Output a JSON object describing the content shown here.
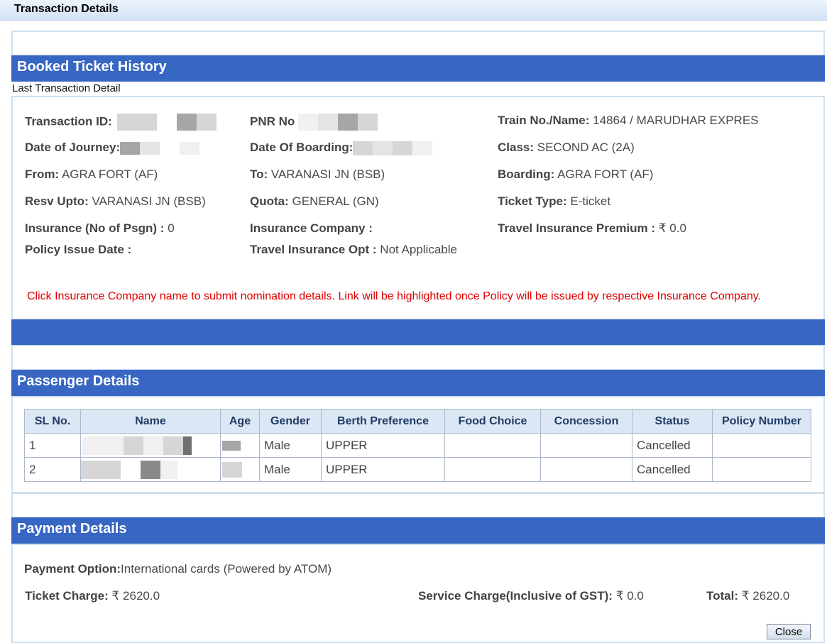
{
  "window": {
    "title": "Transaction Details"
  },
  "booked_section": {
    "title": "Booked Ticket History",
    "subtitle": "Last Transaction Detail"
  },
  "transaction": {
    "transaction_id_label": "Transaction ID:",
    "pnr_label": "PNR No",
    "train_label": "Train No./Name:",
    "train_value": " 14864 /  MARUDHAR EXPRES",
    "doj_label": "Date of Journey:",
    "dob_label": "Date Of Boarding:",
    "class_label": "Class:",
    "class_value": " SECOND AC (2A)",
    "from_label": "From:",
    "from_value": " AGRA FORT (AF)",
    "to_label": "To:",
    "to_value": " VARANASI JN (BSB)",
    "boarding_label": "Boarding:",
    "boarding_value": " AGRA FORT (AF)",
    "resv_label": "Resv Upto:",
    "resv_value": " VARANASI JN (BSB)",
    "quota_label": "Quota:",
    "quota_value": " GENERAL (GN)",
    "ticket_type_label": "Ticket Type:",
    "ticket_type_value": " E-ticket",
    "insurance_psgn_label": "Insurance (No of Psgn) :",
    "insurance_psgn_value": " 0",
    "insurance_company_label": "Insurance Company :",
    "travel_premium_label": "Travel Insurance Premium :",
    "travel_premium_value": " ₹ 0.0",
    "policy_issue_label": "Policy Issue Date :",
    "travel_opt_label": "Travel Insurance Opt :",
    "travel_opt_value": " Not Applicable",
    "notice": "Click Insurance Company name to submit nomination details. Link will be highlighted once Policy will be issued by respective Insurance Company."
  },
  "passenger_section": {
    "title": "Passenger Details",
    "columns": [
      "SL No.",
      "Name",
      "Age",
      "Gender",
      "Berth Preference",
      "Food Choice",
      "Concession",
      "Status",
      "Policy Number"
    ],
    "rows": [
      {
        "sl": "1",
        "gender": "Male",
        "berth": "UPPER",
        "status": "Cancelled"
      },
      {
        "sl": "2",
        "gender": "Male",
        "berth": "UPPER",
        "status": "Cancelled"
      }
    ]
  },
  "payment_section": {
    "title": "Payment Details",
    "option_label": "Payment Option:",
    "option_value": "International cards (Powered by ATOM)",
    "ticket_charge_label": "Ticket Charge:",
    "ticket_charge_value": " ₹ 2620.0",
    "service_charge_label": "Service Charge(Inclusive of GST):",
    "service_charge_value": " ₹ 0.0",
    "total_label": "Total:",
    "total_value": " ₹ 2620.0"
  },
  "close_button": "Close"
}
